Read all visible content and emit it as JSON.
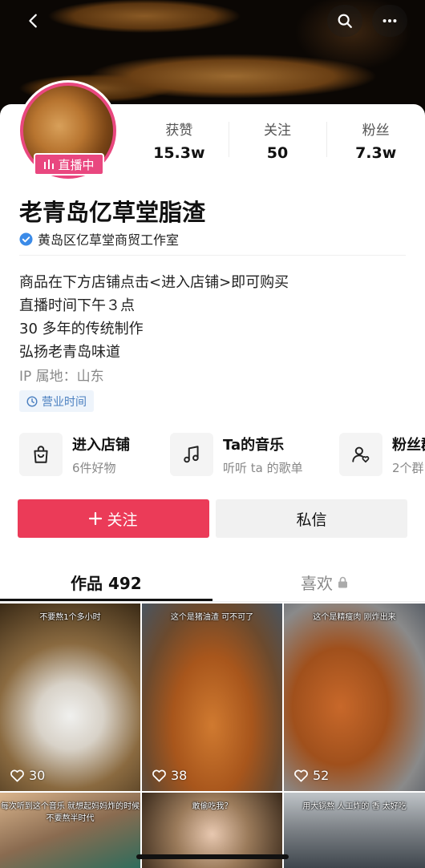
{
  "header": {
    "back_icon": "chevron-left-icon",
    "search_icon": "search-icon",
    "more_icon": "more-icon"
  },
  "profile": {
    "live_badge": "直播中",
    "name": "老青岛亿草堂脂渣",
    "verified_label": "黄岛区亿草堂商贸工作室",
    "verified_color": "#3b8be8",
    "accent": "#e9477f"
  },
  "stats": [
    {
      "label": "获赞",
      "value": "15.3w"
    },
    {
      "label": "关注",
      "value": "50"
    },
    {
      "label": "粉丝",
      "value": "7.3w"
    }
  ],
  "bio": {
    "lines": [
      "商品在下方店铺点击<进入店铺>即可购买",
      "直播时间下午３点",
      "30 多年的传统制作",
      "弘扬老青岛味道"
    ],
    "ip": "IP 属地：山东",
    "hours_label": "营业时间"
  },
  "entries": [
    {
      "title": "进入店铺",
      "sub": "6件好物",
      "icon": "shopping-bag-icon"
    },
    {
      "title": "Ta的音乐",
      "sub": "听听 ta 的歌单",
      "icon": "music-note-icon"
    },
    {
      "title": "粉丝群",
      "sub": "2个群",
      "icon": "fan-group-icon"
    }
  ],
  "actions": {
    "follow": "关注",
    "message": "私信",
    "follow_color": "#eb3b58"
  },
  "tabs": {
    "works": "作品 492",
    "likes": "喜欢"
  },
  "videos": [
    {
      "caption": "不要熬1个多小时",
      "likes": "30"
    },
    {
      "caption": "这个是猪油渣 可不可了",
      "likes": "38"
    },
    {
      "caption": "这个是精瘦肉 刚炸出来",
      "likes": "52"
    },
    {
      "caption": "每次听到这个音乐 就想起妈妈炸的时候 不要熬半时代",
      "likes": ""
    },
    {
      "caption": "敢偷吃我？",
      "likes": ""
    },
    {
      "caption": "用大锅熬 人工炸的 香 太好吃",
      "likes": ""
    }
  ]
}
